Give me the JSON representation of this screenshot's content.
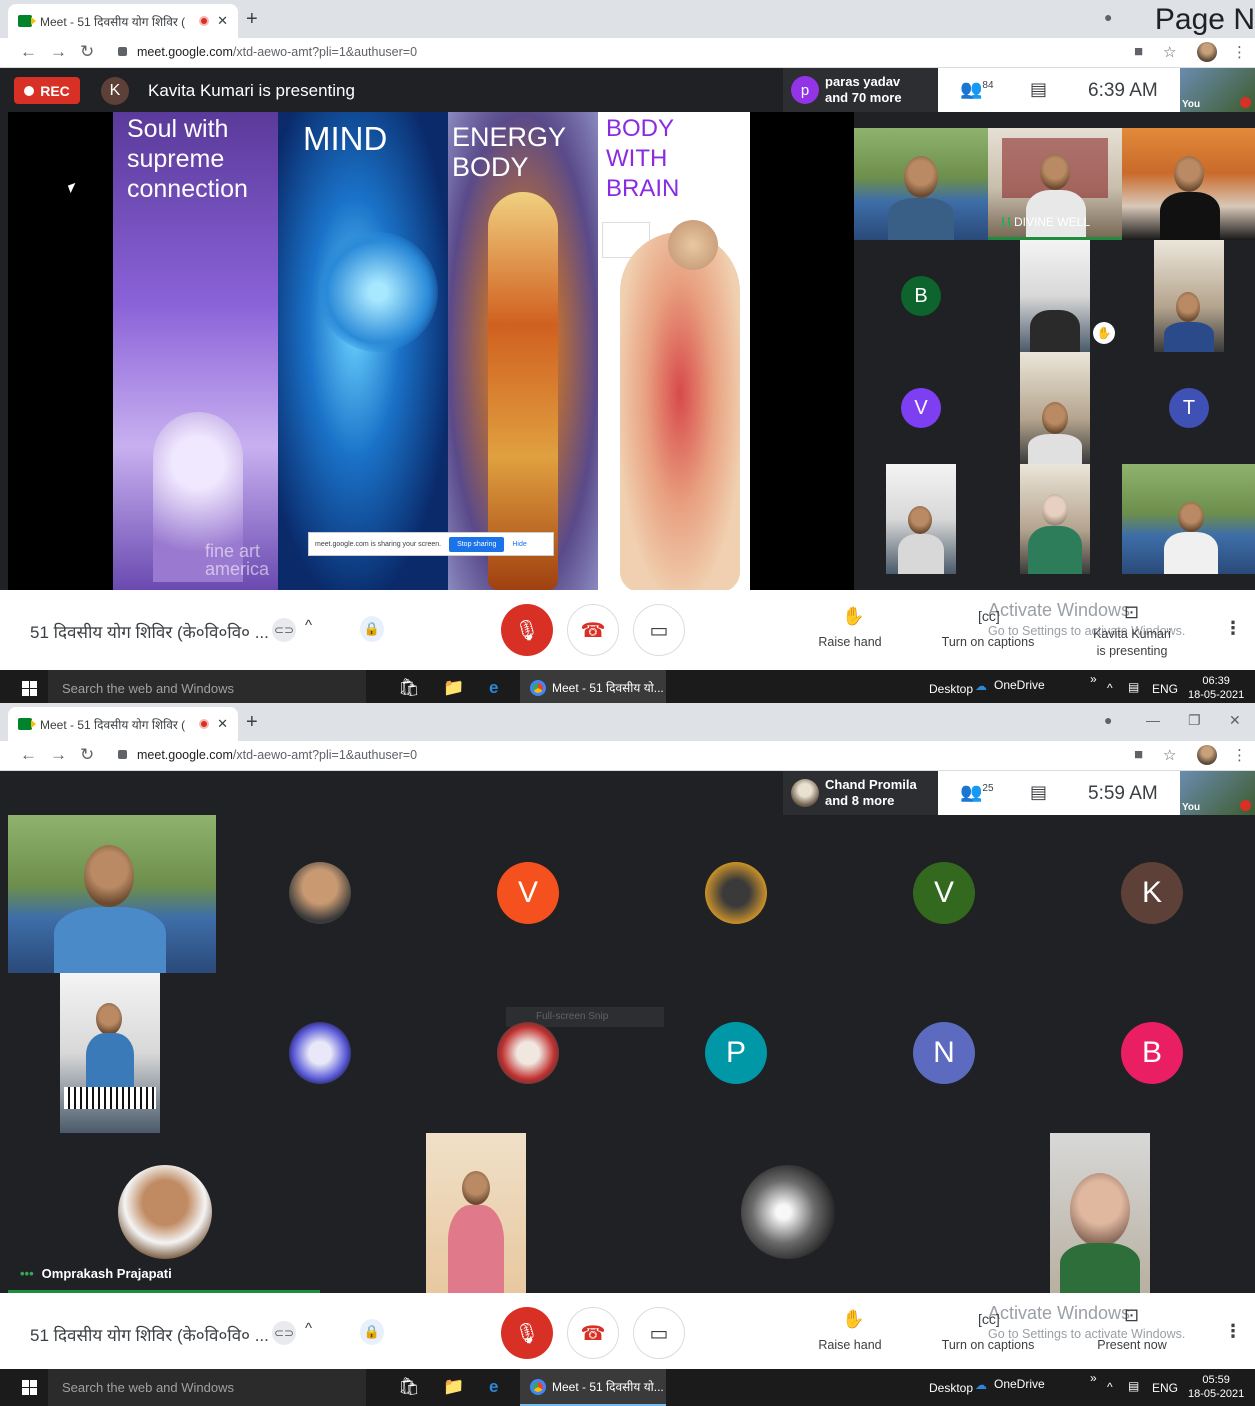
{
  "shot1": {
    "tab_title": "Meet - 51 दिवसीय योग शिविर (",
    "page_name_overlay": "Page N",
    "url_host": "meet.google.com",
    "url_path": "/xtd-aewo-amt?pli=1&authuser=0",
    "rec_label": "REC",
    "presenter_initial": "K",
    "presenting_text": "Kavita Kumari is presenting",
    "participant_initial": "p",
    "participants_line1": "paras yadav",
    "participants_line2": "and 70 more",
    "people_count": "84",
    "time": "6:39 AM",
    "you_label": "You",
    "slide": {
      "panel1": "Soul with supreme connection",
      "panel2": "MIND",
      "panel3": "ENERGY BODY",
      "panel4": "BODY WITH BRAIN",
      "watermark": "fine art america"
    },
    "share_notice": "meet.google.com is sharing your screen.",
    "stop_sharing": "Stop sharing",
    "hide": "Hide",
    "tile_name": "DIVINE WELL",
    "initials": [
      "B",
      "V",
      "T"
    ],
    "meeting_name": "51 दिवसीय योग शिविर (के०वि०वि० ...",
    "raise_hand": "Raise hand",
    "captions": "Turn on captions",
    "present_line1": "Kavita Kumari",
    "present_line2": "is presenting",
    "activate_title": "Activate Windows",
    "activate_sub": "Go to Settings to activate Windows.",
    "taskbar_search": "Search the web and Windows",
    "taskbar_chrome": "Meet - 51 दिवसीय यो...",
    "tray_desktop": "Desktop",
    "tray_onedrive": "OneDrive",
    "tray_lang": "ENG",
    "tray_time": "06:39",
    "tray_date": "18-05-2021"
  },
  "shot2": {
    "tab_title": "Meet - 51 दिवसीय योग शिविर (",
    "url_host": "meet.google.com",
    "url_path": "/xtd-aewo-amt?pli=1&authuser=0",
    "participants_line1": "Chand Promila",
    "participants_line2": "and 8 more",
    "people_count": "25",
    "time": "5:59 AM",
    "you_label": "You",
    "avatars": [
      "V",
      "V",
      "K",
      "P",
      "N",
      "B"
    ],
    "snip_label": "Full-screen Snip",
    "speaker_name": "Omprakash Prajapati",
    "meeting_name": "51 दिवसीय योग शिविर (के०वि०वि० ...",
    "raise_hand": "Raise hand",
    "captions": "Turn on captions",
    "present_now": "Present now",
    "activate_title": "Activate Windows",
    "activate_sub": "Go to Settings to activate Windows.",
    "taskbar_search": "Search the web and Windows",
    "taskbar_chrome": "Meet - 51 दिवसीय यो...",
    "tray_desktop": "Desktop",
    "tray_onedrive": "OneDrive",
    "tray_lang": "ENG",
    "tray_time": "05:59",
    "tray_date": "18-05-2021"
  },
  "colors": {
    "meet_dark": "#202124",
    "rec_red": "#d93025",
    "speaking_green": "#1e8e3e",
    "avatar_orange": "#f4511e",
    "avatar_green": "#33691e",
    "avatar_brown": "#5d4037",
    "avatar_teal": "#0097a7",
    "avatar_indigo": "#5c6bc0",
    "avatar_pink": "#e91e63",
    "avatar_purple": "#9334e6"
  },
  "icons": [
    "meet-icon",
    "recording-dot-icon",
    "close-icon",
    "new-tab-icon",
    "back-icon",
    "forward-icon",
    "reload-icon",
    "lock-icon",
    "camera-icon",
    "star-icon",
    "people-icon",
    "chat-icon",
    "mic-off-icon",
    "hang-up-icon",
    "camera-off-icon",
    "hand-icon",
    "captions-icon",
    "present-icon",
    "more-icon",
    "windows-icon",
    "store-icon",
    "folder-icon",
    "edge-icon",
    "chrome-icon"
  ]
}
